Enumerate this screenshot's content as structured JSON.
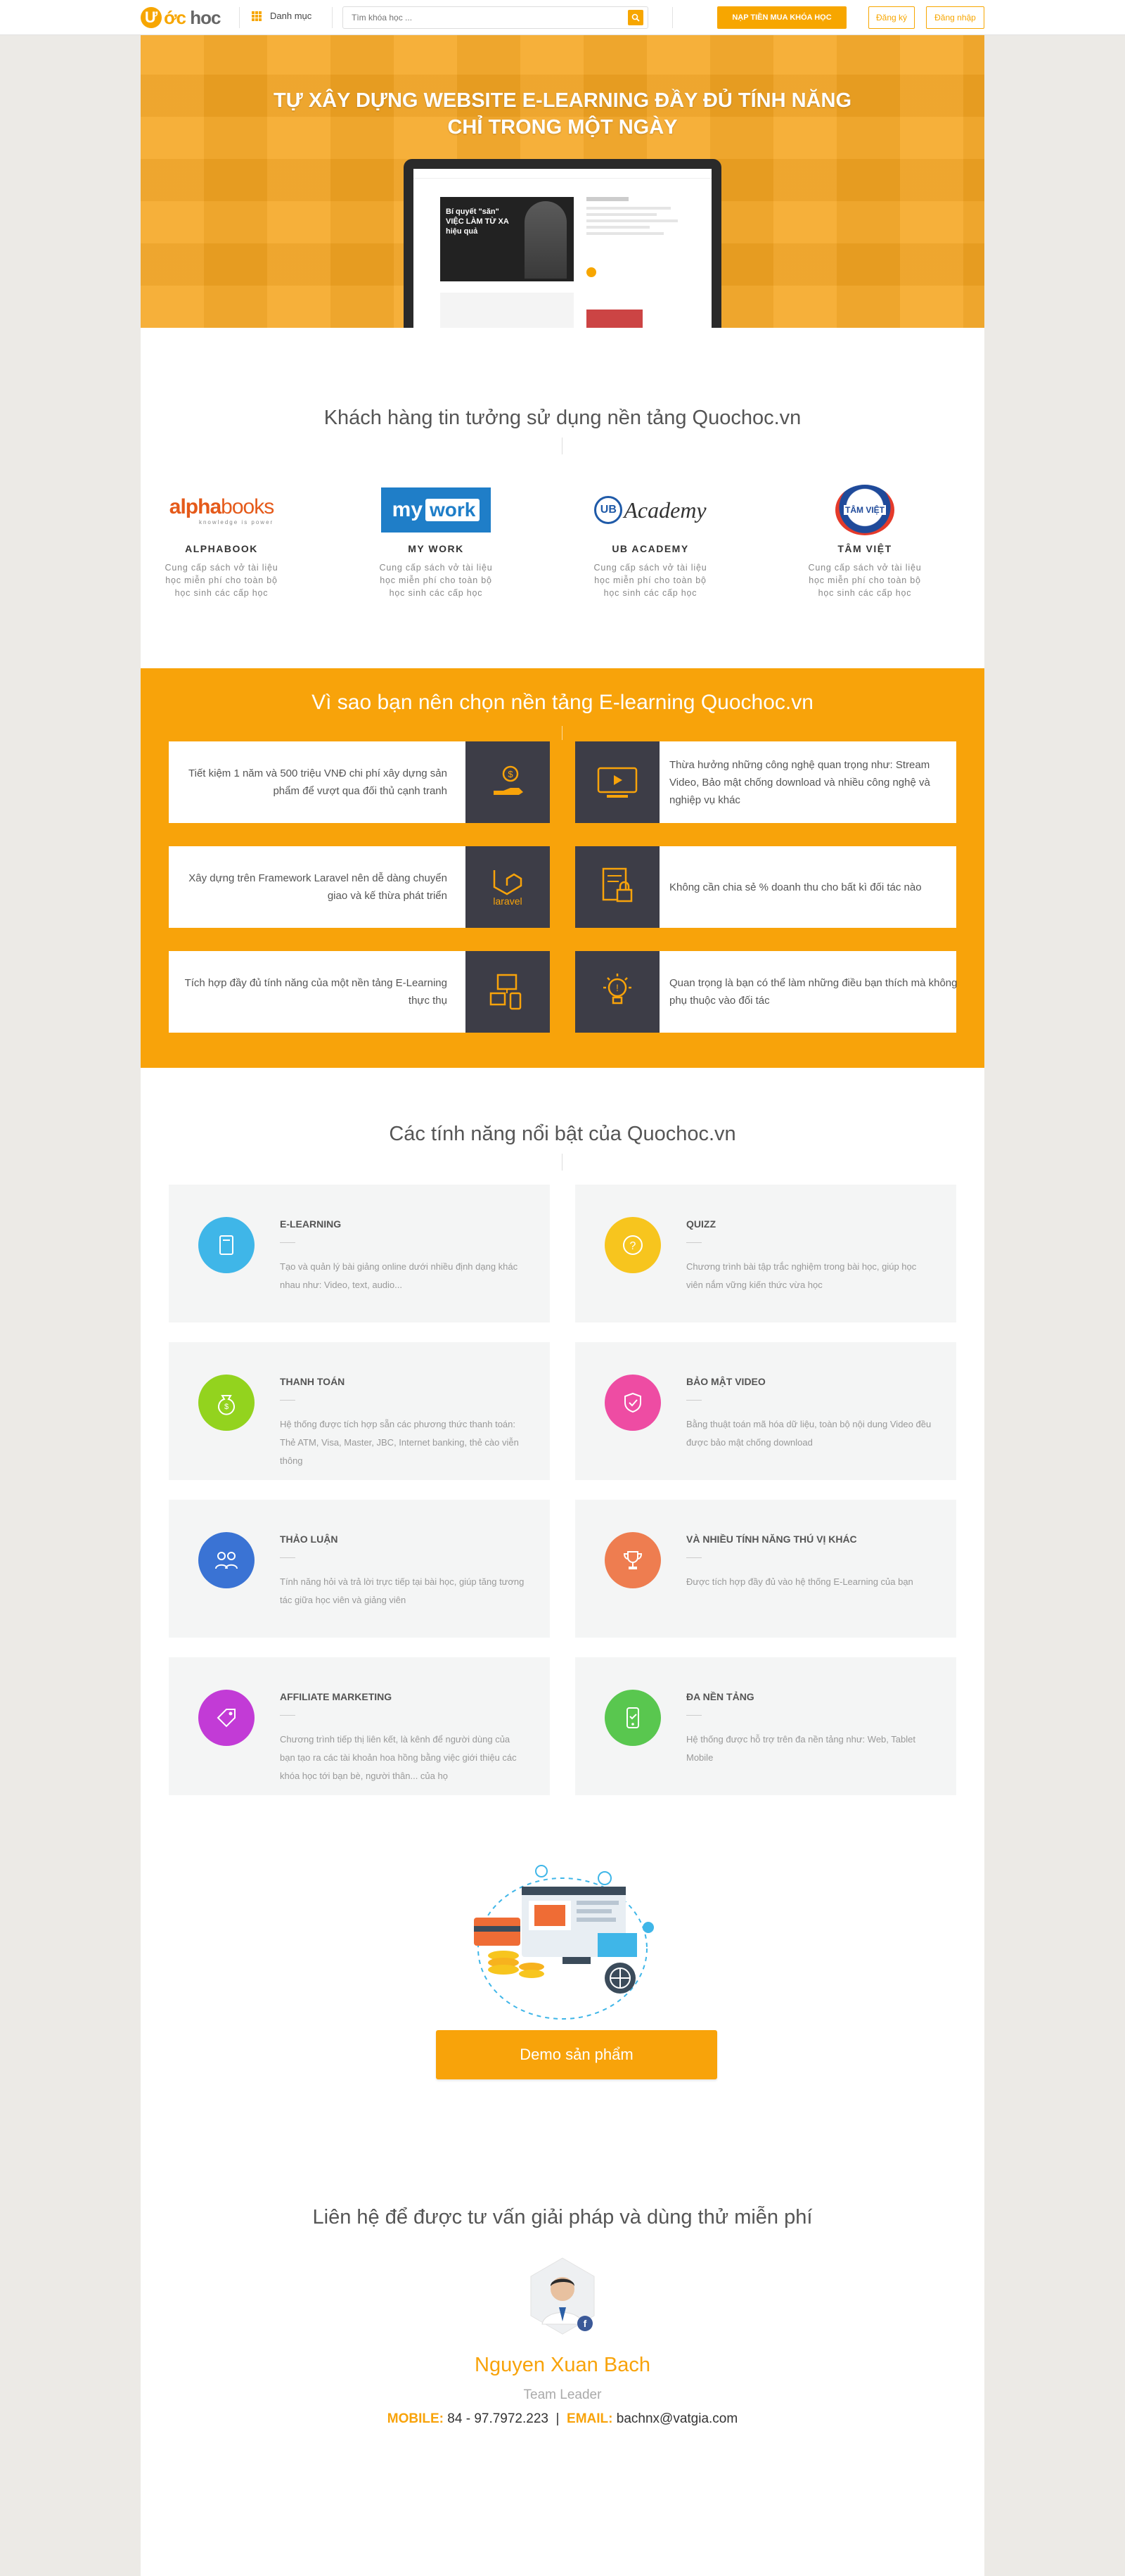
{
  "header": {
    "logo_letter": "Ư",
    "logo_orange": "ớc",
    "logo_gray": "hoc",
    "category_label": "Danh mục",
    "search_placeholder": "Tìm khóa học ...",
    "buy_button": "NẠP TIỀN MUA KHÓA HỌC",
    "register": "Đăng ký",
    "login": "Đăng nhập"
  },
  "hero": {
    "title_line1": "TỰ XÂY DỰNG WEBSITE E-LEARNING ĐẦY ĐỦ TÍNH NĂNG",
    "title_line2": "CHỈ TRONG MỘT NGÀY",
    "screen_headline_1": "Bí quyết \"săn\"",
    "screen_headline_2": "VIỆC LÀM TỪ XA",
    "screen_headline_3": "hiệu quả"
  },
  "clients": {
    "title": "Khách hàng tin tưởng sử dụng nền tảng Quochoc.vn",
    "items": [
      {
        "name": "ALPHABOOK",
        "logo_a": "alpha",
        "logo_b": "books",
        "logo_sub": "knowledge is power",
        "desc": "Cung cấp sách vở tài liệu học miễn phí cho toàn bộ học sinh các cấp học"
      },
      {
        "name": "MY WORK",
        "logo_a": "my",
        "logo_b": "work",
        "desc": "Cung cấp sách vở tài liệu học miễn phí cho toàn bộ học sinh các cấp học"
      },
      {
        "name": "UB ACADEMY",
        "logo_a": "UB",
        "logo_b": "Academy",
        "desc": "Cung cấp sách vở tài liệu học miễn phí cho toàn bộ học sinh các cấp học"
      },
      {
        "name": "TÂM VIỆT",
        "logo_a": "TÂM VIỆT",
        "desc": "Cung cấp sách vở tài liệu học miễn phí cho toàn bộ học sinh các cấp học"
      }
    ]
  },
  "why": {
    "title": "Vì sao bạn nên chọn nền tảng E-learning Quochoc.vn",
    "items": [
      {
        "text": "Tiết kiệm 1 năm và 500 triệu VNĐ chi phí xây dựng sản phẩm để vượt qua đối thủ cạnh tranh",
        "icon": "hand-coin-icon"
      },
      {
        "text": "Thừa hưởng những công nghệ quan trọng như: Stream Video, Bảo mật chống download và nhiều công nghệ và nghiệp vụ khác",
        "icon": "video-certificate-icon"
      },
      {
        "text": "Xây dựng trên Framework Laravel nên dễ dàng chuyển giao và kế thừa phát triển",
        "icon": "laravel-icon",
        "icon_label": "laravel"
      },
      {
        "text": "Không cần chia sẻ % doanh thu cho bất kì đối tác nào",
        "icon": "document-lock-icon"
      },
      {
        "text": "Tích hợp đầy đủ tính năng của một nền tảng E-Learning thực thụ",
        "icon": "devices-icon"
      },
      {
        "text": "Quan trọng là bạn có thể làm những điều bạn thích mà không phụ thuộc vào đối tác",
        "icon": "lightbulb-icon"
      }
    ]
  },
  "features": {
    "title": "Các tính năng nổi bật của Quochoc.vn",
    "items": [
      {
        "title": "E-LEARNING",
        "desc": "Tạo và quản lý bài giảng online dưới nhiều định dạng khác nhau như: Video, text, audio...",
        "color": "#3fb6e8",
        "icon": "book-icon"
      },
      {
        "title": "QUIZZ",
        "desc": "Chương trình bài tập trắc nghiệm trong bài học, giúp học viên nắm vững kiến thức vừa học",
        "color": "#f7c51e",
        "icon": "question-icon"
      },
      {
        "title": "THANH TOÁN",
        "desc": "Hệ thống được tích hợp sẵn các phương thức thanh toán: Thẻ ATM, Visa, Master, JBC, Internet banking, thẻ cào viễn thông",
        "color": "#93d31e",
        "icon": "money-bag-icon"
      },
      {
        "title": "BẢO MẬT VIDEO",
        "desc": "Bằng thuật toán mã hóa dữ liệu, toàn bộ nội dung Video đều được bảo mật chống download",
        "color": "#ee4ca3",
        "icon": "shield-icon"
      },
      {
        "title": "THẢO LUẬN",
        "desc": "Tính năng hỏi và trả lời trực tiếp tại bài học, giúp tăng tương tác giữa học viên và giảng viên",
        "color": "#3a73d4",
        "icon": "discussion-icon"
      },
      {
        "title": "VÀ NHIỀU TÍNH NĂNG THÚ VỊ KHÁC",
        "desc": "Được tích hợp đầy đủ vào hệ thống E-Learning của bạn",
        "color": "#ee7d50",
        "icon": "trophy-icon"
      },
      {
        "title": "AFFILIATE MARKETING",
        "desc": "Chương trình tiếp thị liên kết, là kênh để người dùng của bạn tạo ra các tài khoản hoa hồng bằng việc giới thiệu các khóa học tới bạn bè, người thân... của họ",
        "color": "#c23bd6",
        "icon": "tag-icon"
      },
      {
        "title": "ĐA NỀN TẢNG",
        "desc": "Hệ thống được hỗ trợ trên đa nền tảng như: Web, Tablet Mobile",
        "color": "#59c74f",
        "icon": "mobile-icon"
      }
    ]
  },
  "demo": {
    "button": "Demo sản phẩm"
  },
  "contact": {
    "title": "Liên hệ để được tư vấn giải pháp và dùng thử miễn phí",
    "name": "Nguyen Xuan Bach",
    "role": "Team Leader",
    "mobile_label": "MOBILE:",
    "mobile": "84 - 97.7972.223",
    "separator": "|",
    "email_label": "EMAIL:",
    "email": "bachnx@vatgia.com"
  },
  "colors": {
    "brand": "#f7a600",
    "why_bg": "#f8a30a",
    "why_icon_bg": "#3d3d47"
  }
}
